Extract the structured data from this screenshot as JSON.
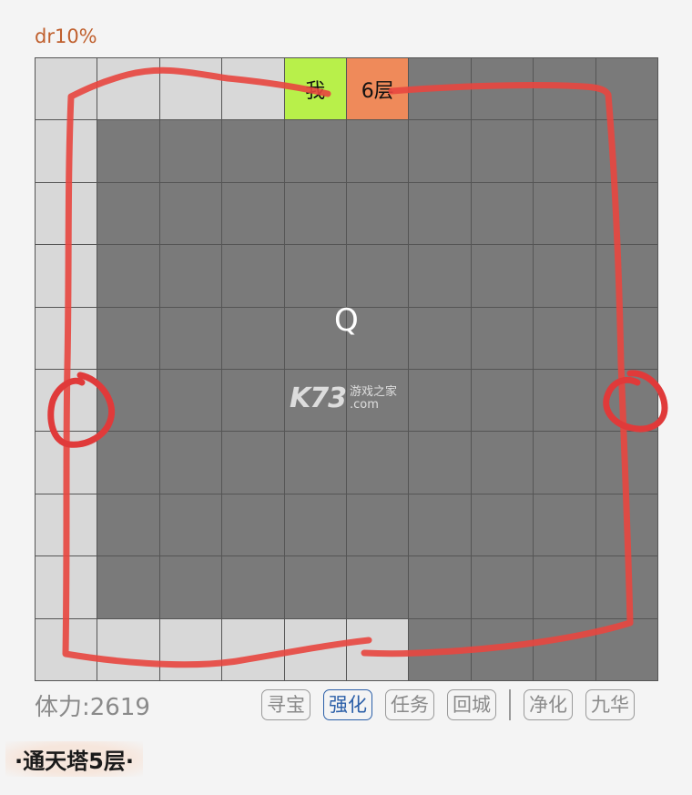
{
  "header": {
    "dr_label": "dr10%"
  },
  "grid": {
    "rows": 10,
    "cols": 10,
    "light_cells": [
      [
        0,
        0
      ],
      [
        0,
        1
      ],
      [
        0,
        2
      ],
      [
        0,
        3
      ],
      [
        1,
        0
      ],
      [
        2,
        0
      ],
      [
        3,
        0
      ],
      [
        4,
        0
      ],
      [
        5,
        0
      ],
      [
        6,
        0
      ],
      [
        7,
        0
      ],
      [
        8,
        0
      ],
      [
        9,
        0
      ],
      [
        9,
        1
      ],
      [
        9,
        2
      ],
      [
        9,
        3
      ],
      [
        9,
        4
      ],
      [
        9,
        5
      ]
    ],
    "me_cell": {
      "row": 0,
      "col": 4,
      "label": "我"
    },
    "floor_cell": {
      "row": 0,
      "col": 5,
      "label": "6层"
    },
    "center_mark": "Q"
  },
  "watermark": {
    "logo": "K73",
    "line1": "游戏之家",
    "line2": ".com"
  },
  "status": {
    "stamina": "体力:2619"
  },
  "actions": [
    {
      "label": "寻宝",
      "active": false
    },
    {
      "label": "强化",
      "active": true
    },
    {
      "label": "任务",
      "active": false
    },
    {
      "label": "回城",
      "active": false
    },
    {
      "label": "净化",
      "active": false
    },
    {
      "label": "九华",
      "active": false
    }
  ],
  "footer": {
    "tower_title": "·通天塔5层·"
  },
  "colors": {
    "dark_cell": "#7a7a7a",
    "light_cell": "#d8d8d8",
    "me_cell": "#b8f04a",
    "floor_cell": "#ef8a5a",
    "path_stroke": "#e03a3a"
  }
}
